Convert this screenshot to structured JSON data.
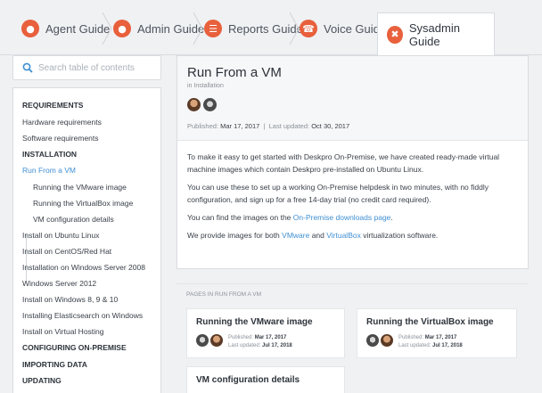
{
  "tabs": [
    {
      "label": "Agent Guide",
      "icon": "group-icon"
    },
    {
      "label": "Admin Guide",
      "icon": "user-icon"
    },
    {
      "label": "Reports Guide",
      "icon": "list-icon"
    },
    {
      "label": "Voice Guide",
      "icon": "phone-icon"
    },
    {
      "label": "Sysadmin Guide",
      "icon": "tools-icon"
    }
  ],
  "search": {
    "placeholder": "Search table of contents"
  },
  "toc": [
    {
      "label": "REQUIREMENTS",
      "type": "heading"
    },
    {
      "label": "Hardware requirements",
      "type": "item"
    },
    {
      "label": "Software requirements",
      "type": "item"
    },
    {
      "label": "INSTALLATION",
      "type": "heading"
    },
    {
      "label": "Run From a VM",
      "type": "active"
    },
    {
      "label": "Running the VMware image",
      "type": "sub"
    },
    {
      "label": "Running the VirtualBox image",
      "type": "sub"
    },
    {
      "label": "VM configuration details",
      "type": "sub"
    },
    {
      "label": "Install on Ubuntu Linux",
      "type": "item"
    },
    {
      "label": "Install on CentOS/Red Hat",
      "type": "item"
    },
    {
      "label": "Installation on Windows Server 2008",
      "type": "item"
    },
    {
      "label": "Windows Server 2012",
      "type": "item"
    },
    {
      "label": "Install on Windows 8, 9 & 10",
      "type": "item"
    },
    {
      "label": "Installing Elasticsearch on Windows",
      "type": "item"
    },
    {
      "label": "Install on Virtual Hosting",
      "type": "item"
    },
    {
      "label": "CONFIGURING ON-PREMISE",
      "type": "heading"
    },
    {
      "label": "IMPORTING DATA",
      "type": "heading"
    },
    {
      "label": "UPDATING",
      "type": "heading"
    }
  ],
  "article": {
    "title": "Run From a VM",
    "category": "in Installation",
    "published_label": "Published:",
    "published": "Mar 17, 2017",
    "separator": "|",
    "updated_label": "Last updated:",
    "updated": "Oct 30, 2017",
    "p1": "To make it easy to get started with Deskpro On-Premise, we have created ready-made virtual machine images which contain Deskpro pre-installed on Ubuntu Linux.",
    "p2": "You can use these to set up a working On-Premise helpdesk in two minutes, with no fiddly configuration, and sign up for a free 14-day trial (no credit card required).",
    "p3_pre": "You can find the images on the ",
    "p3_link": "On-Premise downloads page",
    "p3_post": ".",
    "p4_pre": "We provide images for both ",
    "p4_link1": "VMware",
    "p4_mid": " and ",
    "p4_link2": "VirtualBox",
    "p4_post": " virtualization software."
  },
  "pages": {
    "label": "PAGES IN RUN FROM A VM",
    "cards": [
      {
        "title": "Running the VMware image",
        "published_label": "Published:",
        "published": "Mar 17, 2017",
        "updated_label": "Last updated:",
        "updated": "Jul 17, 2018"
      },
      {
        "title": "Running the VirtualBox image",
        "published_label": "Published:",
        "published": "Mar 17, 2017",
        "updated_label": "Last updated:",
        "updated": "Jul 17, 2018"
      },
      {
        "title": "VM configuration details"
      }
    ]
  },
  "colors": {
    "accent": "#e8603c",
    "link": "#3f8fd2"
  }
}
